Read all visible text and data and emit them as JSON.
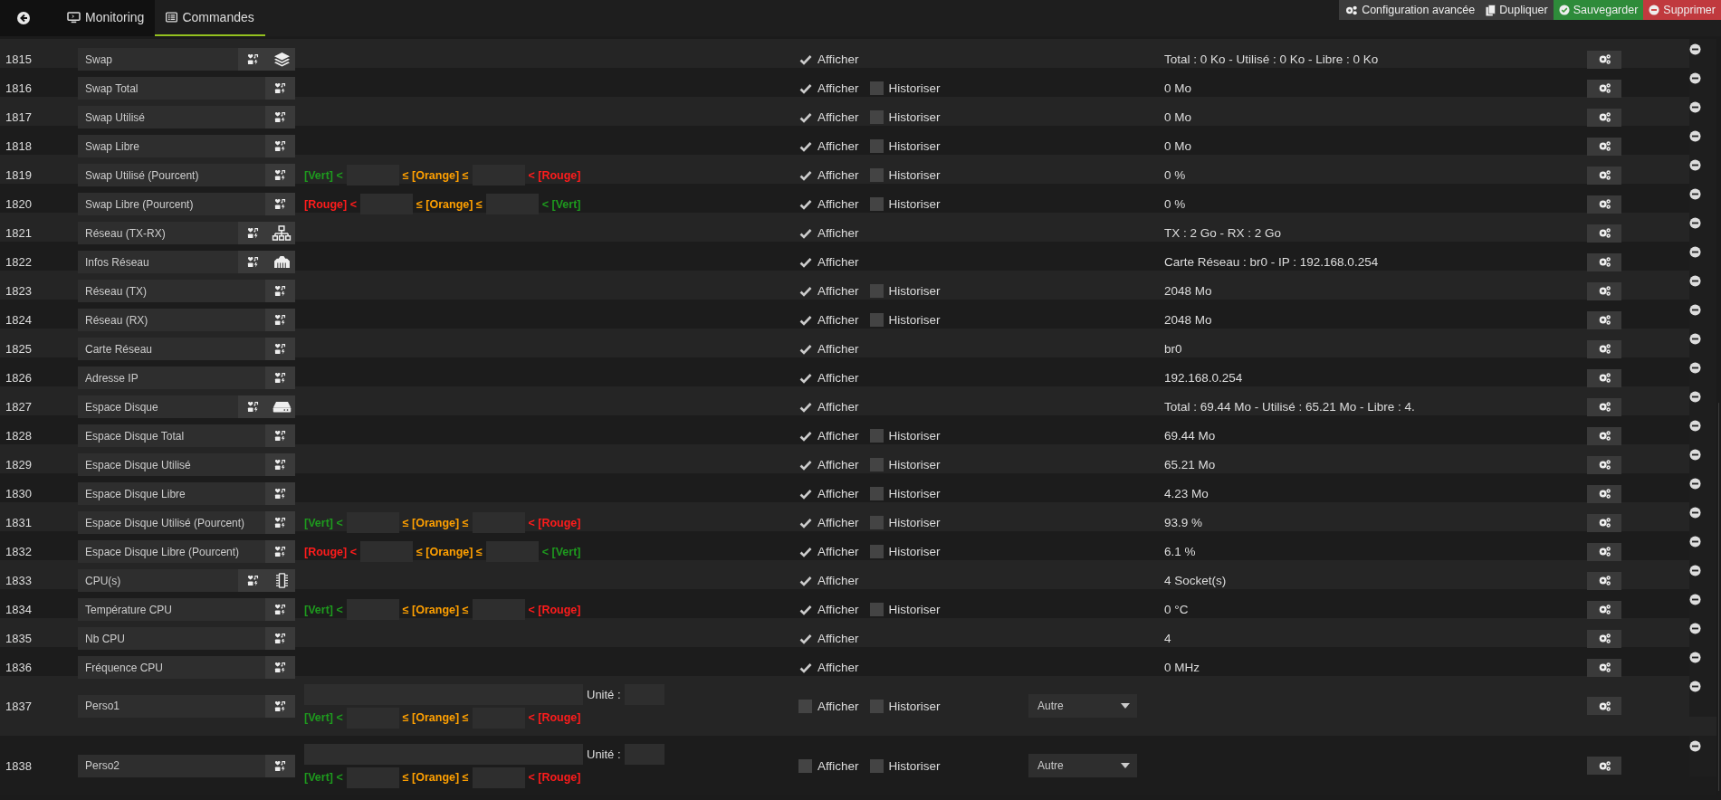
{
  "tabs": [
    {
      "label": "Monitoring",
      "kind": "monitor",
      "selected": false
    },
    {
      "label": "Commandes",
      "kind": "list",
      "selected": true
    }
  ],
  "actions": [
    {
      "label": "Configuration avancée",
      "kind": "config"
    },
    {
      "label": "Dupliquer",
      "kind": "duplicate"
    },
    {
      "label": "Sauvegarder",
      "kind": "save"
    },
    {
      "label": "Supprimer",
      "kind": "delete"
    }
  ],
  "commands": [
    {
      "id": "1815",
      "kind": "info",
      "name": "Swap",
      "type_badge": {
        "kind": "layers"
      },
      "show": true,
      "show_label": "Afficher",
      "value": "Total : 0 Ko - Utilisé : 0 Ko - Libre : 0 Ko"
    },
    {
      "id": "1816",
      "kind": "numeric",
      "name": "Swap Total",
      "show": true,
      "show_label": "Afficher",
      "history": false,
      "history_label": "Historiser",
      "value": "0 Mo"
    },
    {
      "id": "1817",
      "kind": "numeric",
      "name": "Swap Utilisé",
      "show": true,
      "show_label": "Afficher",
      "history": false,
      "history_label": "Historiser",
      "value": "0 Mo"
    },
    {
      "id": "1818",
      "kind": "numeric",
      "name": "Swap Libre",
      "show": true,
      "show_label": "Afficher",
      "history": false,
      "history_label": "Historiser",
      "value": "0 Mo"
    },
    {
      "id": "1819",
      "kind": "numeric",
      "name": "Swap Utilisé (Pourcent)",
      "thresholds": [
        {
          "text": "[Vert] <",
          "color": "#1e9a1e"
        },
        {
          "text": "≤ [Orange] ≤",
          "color": "#ffa000"
        },
        {
          "text": "< [Rouge]",
          "color": "#ff1c1c"
        }
      ],
      "show": true,
      "show_label": "Afficher",
      "history": false,
      "history_label": "Historiser",
      "value": "0 %"
    },
    {
      "id": "1820",
      "kind": "numeric",
      "name": "Swap Libre (Pourcent)",
      "thresholds": [
        {
          "text": "[Rouge] <",
          "color": "#ff1c1c"
        },
        {
          "text": "≤ [Orange] ≤",
          "color": "#ffa000"
        },
        {
          "text": "< [Vert]",
          "color": "#1e9a1e"
        }
      ],
      "show": true,
      "show_label": "Afficher",
      "history": false,
      "history_label": "Historiser",
      "value": "0 %"
    },
    {
      "id": "1821",
      "kind": "info",
      "name": "Réseau (TX-RX)",
      "type_badge": {
        "kind": "network"
      },
      "show": true,
      "show_label": "Afficher",
      "value": "TX : 2 Go - RX : 2 Go"
    },
    {
      "id": "1822",
      "kind": "info",
      "name": "Infos Réseau",
      "type_badge": {
        "kind": "ethernet"
      },
      "show": true,
      "show_label": "Afficher",
      "value": "Carte Réseau : br0 - IP : 192.168.0.254"
    },
    {
      "id": "1823",
      "kind": "numeric",
      "name": "Réseau (TX)",
      "show": true,
      "show_label": "Afficher",
      "history": false,
      "history_label": "Historiser",
      "value": "2048 Mo"
    },
    {
      "id": "1824",
      "kind": "numeric",
      "name": "Réseau (RX)",
      "show": true,
      "show_label": "Afficher",
      "history": false,
      "history_label": "Historiser",
      "value": "2048 Mo"
    },
    {
      "id": "1825",
      "kind": "info",
      "name": "Carte Réseau",
      "show": true,
      "show_label": "Afficher",
      "value": "br0"
    },
    {
      "id": "1826",
      "kind": "info",
      "name": "Adresse IP",
      "show": true,
      "show_label": "Afficher",
      "value": "192.168.0.254"
    },
    {
      "id": "1827",
      "kind": "info",
      "name": "Espace Disque",
      "type_badge": {
        "kind": "disk"
      },
      "show": true,
      "show_label": "Afficher",
      "value": "Total : 69.44 Mo - Utilisé : 65.21 Mo - Libre : 4."
    },
    {
      "id": "1828",
      "kind": "numeric",
      "name": "Espace Disque Total",
      "show": true,
      "show_label": "Afficher",
      "history": false,
      "history_label": "Historiser",
      "value": "69.44 Mo"
    },
    {
      "id": "1829",
      "kind": "numeric",
      "name": "Espace Disque Utilisé",
      "show": true,
      "show_label": "Afficher",
      "history": false,
      "history_label": "Historiser",
      "value": "65.21 Mo"
    },
    {
      "id": "1830",
      "kind": "numeric",
      "name": "Espace Disque Libre",
      "show": true,
      "show_label": "Afficher",
      "history": false,
      "history_label": "Historiser",
      "value": "4.23 Mo"
    },
    {
      "id": "1831",
      "kind": "numeric",
      "name": "Espace Disque Utilisé (Pourcent)",
      "thresholds": [
        {
          "text": "[Vert] <",
          "color": "#1e9a1e"
        },
        {
          "text": "≤ [Orange] ≤",
          "color": "#ffa000"
        },
        {
          "text": "< [Rouge]",
          "color": "#ff1c1c"
        }
      ],
      "show": true,
      "show_label": "Afficher",
      "history": false,
      "history_label": "Historiser",
      "value": "93.9 %"
    },
    {
      "id": "1832",
      "kind": "numeric",
      "name": "Espace Disque Libre (Pourcent)",
      "thresholds": [
        {
          "text": "[Rouge] <",
          "color": "#ff1c1c"
        },
        {
          "text": "≤ [Orange] ≤",
          "color": "#ffa000"
        },
        {
          "text": "< [Vert]",
          "color": "#1e9a1e"
        }
      ],
      "show": true,
      "show_label": "Afficher",
      "history": false,
      "history_label": "Historiser",
      "value": "6.1 %"
    },
    {
      "id": "1833",
      "kind": "info",
      "name": "CPU(s)",
      "type_badge": {
        "kind": "chip"
      },
      "show": true,
      "show_label": "Afficher",
      "value": "4 Socket(s)"
    },
    {
      "id": "1834",
      "kind": "numeric",
      "name": "Température CPU",
      "thresholds": [
        {
          "text": "[Vert] <",
          "color": "#1e9a1e"
        },
        {
          "text": "≤ [Orange] ≤",
          "color": "#ffa000"
        },
        {
          "text": "< [Rouge]",
          "color": "#ff1c1c"
        }
      ],
      "show": true,
      "show_label": "Afficher",
      "history": false,
      "history_label": "Historiser",
      "value": "0 °C"
    },
    {
      "id": "1835",
      "kind": "info",
      "name": "Nb CPU",
      "show": true,
      "show_label": "Afficher",
      "value": "4"
    },
    {
      "id": "1836",
      "kind": "info",
      "name": "Fréquence CPU",
      "show": true,
      "show_label": "Afficher",
      "value": "0 MHz"
    },
    {
      "id": "1837",
      "kind": "custom",
      "name": "Perso1",
      "unit_label": "Unité :",
      "thresholds": [
        {
          "text": "[Vert] <",
          "color": "#1e9a1e"
        },
        {
          "text": "≤ [Orange] ≤",
          "color": "#ffa000"
        },
        {
          "text": "< [Rouge]",
          "color": "#ff1c1c"
        }
      ],
      "show": false,
      "show_label": "Afficher",
      "history": false,
      "history_label": "Historiser",
      "subtype": "Autre"
    },
    {
      "id": "1838",
      "kind": "custom",
      "name": "Perso2",
      "unit_label": "Unité :",
      "thresholds": [
        {
          "text": "[Vert] <",
          "color": "#1e9a1e"
        },
        {
          "text": "≤ [Orange] ≤",
          "color": "#ffa000"
        },
        {
          "text": "< [Rouge]",
          "color": "#ff1c1c"
        }
      ],
      "show": false,
      "show_label": "Afficher",
      "history": false,
      "history_label": "Historiser",
      "subtype": "Autre"
    }
  ]
}
